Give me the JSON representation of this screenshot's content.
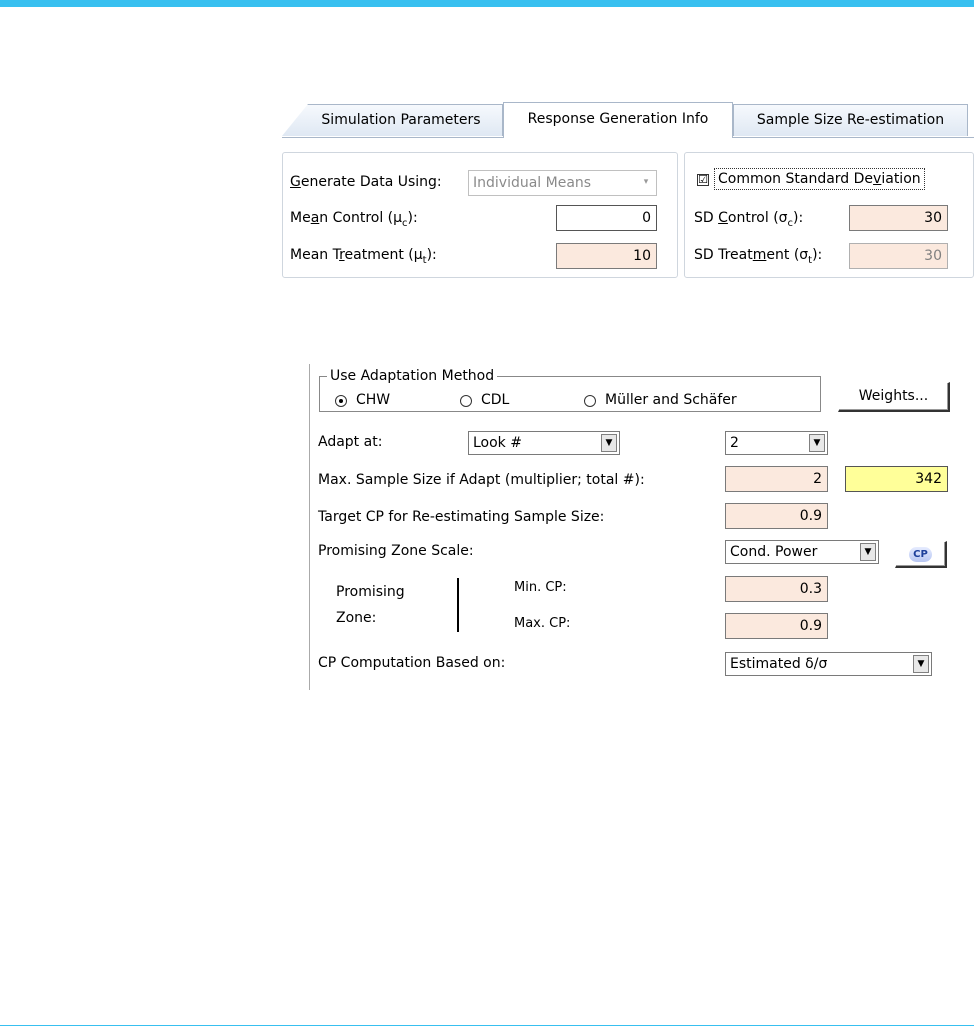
{
  "tabs": [
    {
      "label": "Simulation Parameters"
    },
    {
      "label": "Response Generation Info"
    },
    {
      "label": "Sample Size Re-estimation"
    }
  ],
  "response": {
    "generate_label_u": "G",
    "generate_label_rest": "enerate Data Using:",
    "generate_value": "Individual Means",
    "mean_control_pre": "Me",
    "mean_control_u": "a",
    "mean_control_post": "n Control (μ",
    "mean_control_sub": "c",
    "mean_control_end": "):",
    "mean_control_value": "0",
    "mean_treatment_pre": "Mean T",
    "mean_treatment_u": "r",
    "mean_treatment_post": "eatment (μ",
    "mean_treatment_sub": "t",
    "mean_treatment_end": "):",
    "mean_treatment_value": "10",
    "common_sd_pre": "Common Standard De",
    "common_sd_u": "v",
    "common_sd_post": "iation",
    "common_sd_checked": "☑",
    "sd_control_pre": "SD ",
    "sd_control_u": "C",
    "sd_control_post": "ontrol (σ",
    "sd_control_sub": "c",
    "sd_control_end": "):",
    "sd_control_value": "30",
    "sd_treatment_pre": "SD Treat",
    "sd_treatment_u": "m",
    "sd_treatment_post": "ent (σ",
    "sd_treatment_sub": "t",
    "sd_treatment_end": "):",
    "sd_treatment_value": "30"
  },
  "adaptation": {
    "group_label": "Use Adaptation Method",
    "options": [
      "CHW",
      "CDL",
      "Müller and Schäfer"
    ],
    "selected": "CHW",
    "weights_button": "Weights...",
    "adapt_at_label": "Adapt at:",
    "adapt_at_value": "Look #",
    "look_value": "2",
    "max_ss_label": "Max. Sample Size if Adapt (multiplier; total #):",
    "max_ss_multiplier": "2",
    "max_ss_total": "342",
    "target_cp_label": "Target CP for Re-estimating Sample Size:",
    "target_cp_value": "0.9",
    "zone_scale_label": "Promising Zone Scale:",
    "zone_scale_value": "Cond. Power",
    "cp_button": "CP",
    "promising": "Promising",
    "zone": "Zone:",
    "min_cp_label": "Min. CP:",
    "min_cp_value": "0.3",
    "max_cp_label": "Max. CP:",
    "max_cp_value": "0.9",
    "cp_based_label": "CP Computation Based on:",
    "cp_based_value": "Estimated δ/σ"
  },
  "colors": {
    "accent_bar": "#38c0f0",
    "input_peach": "#fbe9de",
    "highlight_yellow": "#ffff99"
  }
}
